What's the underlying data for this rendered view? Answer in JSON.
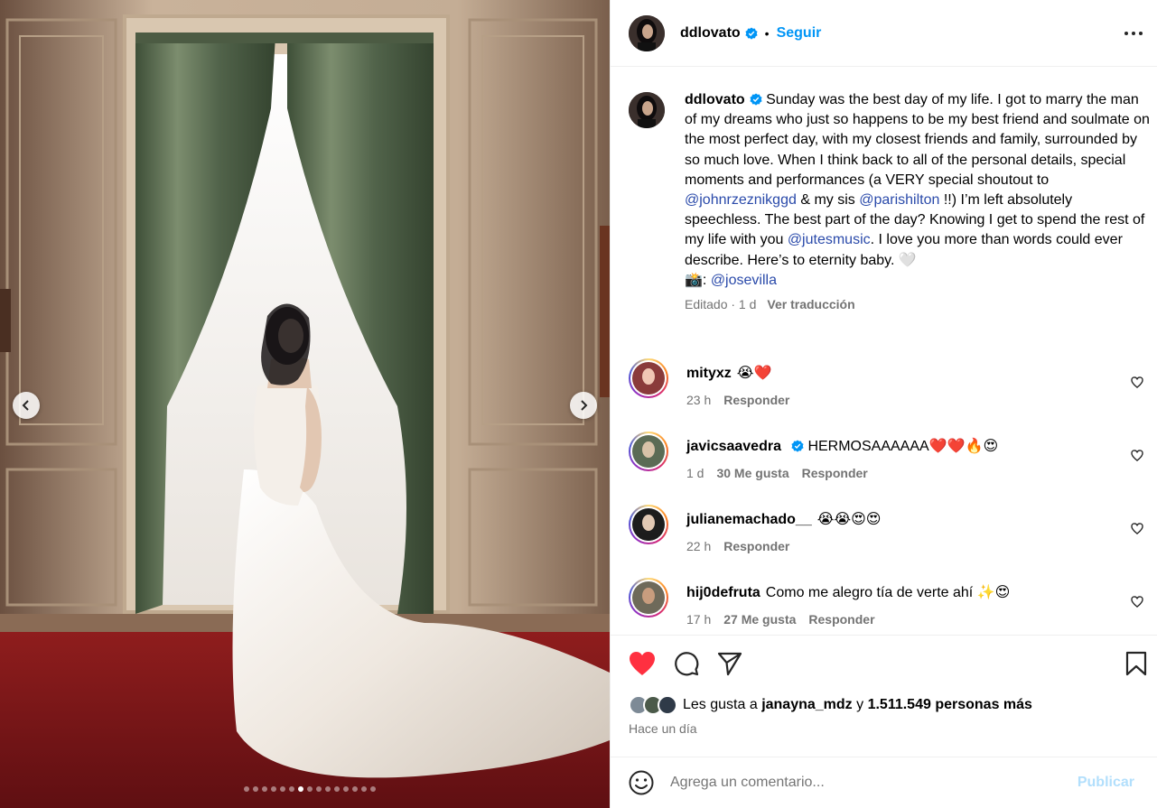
{
  "post": {
    "author": "ddlovato",
    "follow_label": "Seguir",
    "separator": "•",
    "carousel": {
      "total_slides": 15,
      "active_slide": 7
    }
  },
  "caption": {
    "author": "ddlovato",
    "text_1": "Sunday was the best day of my life. I got to marry the man of my dreams who just so happens to be my best friend and soulmate on the most perfect day, with my closest friends and family, surrounded by so much love. When I think back to all of the personal details, special moments and performances (a VERY special shoutout to ",
    "mention_1": "@johnrzeznikggd",
    "text_2": " & my sis ",
    "mention_2": "@parishilton",
    "text_3": " !!) I’m left absolutely speechless. The best part of the day? Knowing I get to spend the rest of my life with you ",
    "mention_3": "@jutesmusic",
    "text_4": ". I love you more than words could ever describe. Here’s to eternity baby. 🤍",
    "photo_credit_prefix": "📸: ",
    "mention_4": "@josevilla",
    "meta": "Editado · 1 d",
    "translate_label": "Ver traducción"
  },
  "comments": [
    {
      "user": "mityxz",
      "verified": false,
      "text": "😭❤️",
      "time": "23 h",
      "likes": "",
      "reply": "Responder"
    },
    {
      "user": "javicsaavedra",
      "verified": true,
      "text": "HERMOSAAAAAA❤️❤️🔥😍",
      "time": "1 d",
      "likes": "30 Me gusta",
      "reply": "Responder"
    },
    {
      "user": "julianemachado__",
      "verified": false,
      "text": "😭😭😍😍",
      "time": "22 h",
      "likes": "",
      "reply": "Responder"
    },
    {
      "user": "hij0defruta",
      "verified": false,
      "text": "Como me alegro tía de verte ahí ✨😍",
      "time": "17 h",
      "likes": "27 Me gusta",
      "reply": "Responder"
    }
  ],
  "likes": {
    "prefix": "Les gusta a ",
    "first_user": "janayna_mdz",
    "joiner": " y ",
    "others": "1.511.549 personas más"
  },
  "posted_ago": "Hace un día",
  "composer": {
    "placeholder": "Agrega un comentario...",
    "publish_label": "Publicar"
  },
  "colors": {
    "accent": "#0095f6",
    "liked_heart": "#ff3040",
    "mention": "#2a4aaa",
    "muted": "#737373"
  }
}
